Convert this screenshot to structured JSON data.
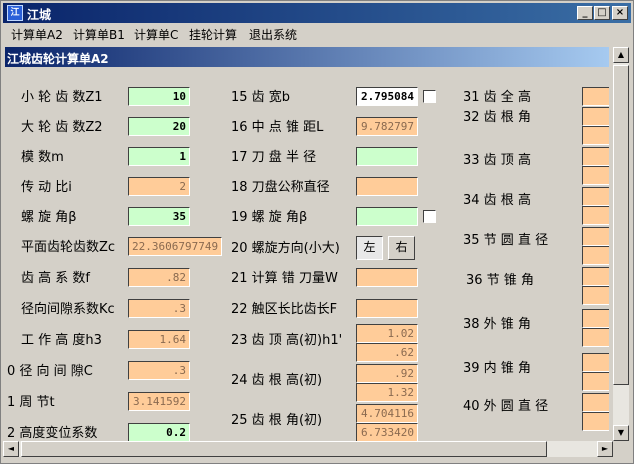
{
  "window": {
    "title": "江城",
    "icon": "app-icon"
  },
  "menu": [
    "计算单A2",
    "计算单B1",
    "计算单C",
    "挂轮计算",
    "退出系统"
  ],
  "child_title": "江城齿轮计算单A2",
  "col1": {
    "labels": [
      "小 轮 齿 数Z1",
      "大 轮 齿 数Z2",
      "模    数m",
      "传  动  比i",
      "螺  旋  角β",
      "平面齿轮齿数Zc",
      "齿 高 系 数f",
      "径向间隙系数Kc",
      "工 作  高 度h3",
      "0 径 向  间 隙C",
      "1 周         节t",
      "2 高度变位系数"
    ],
    "values": [
      "10",
      "20",
      "1",
      "2",
      "35",
      "22.3606797749",
      ".82",
      ".3",
      "1.64",
      ".3",
      "3.141592",
      "0.2"
    ]
  },
  "col2": {
    "labels": [
      "15 齿         宽b",
      "16 中 点  锥 距L",
      "17 刀 盘  半 径",
      "18 刀盘公称直径",
      "19 螺   旋   角β",
      "20 螺旋方向(小大)",
      "21 计算 错 刀量W",
      "22 触区长比齿长F",
      "23 齿 顶 高(初)h1'",
      "24 齿 根 高(初)",
      "25 齿 根 角(初)"
    ],
    "values": {
      "b": "2.795084",
      "L": "9.782797",
      "r": "",
      "D": "",
      "beta": "",
      "W": "",
      "F": "",
      "h1a": "1.02",
      "h1b": ".62",
      "hfa": ".92",
      "hfb": "1.32",
      "tha": "4.704116",
      "thb": "6.733420"
    },
    "dir_left": "左",
    "dir_right": "右"
  },
  "col3": {
    "labels": [
      "31 齿   全   高",
      "32 齿   根   角",
      "33 齿   顶   高",
      "34 齿   根   高",
      "35 节 圆  直 径",
      "36 节   锥   角",
      "38 外   锥   角",
      "39 内   锥   角",
      "40 外 圆  直 径"
    ]
  },
  "colors": {
    "green": "#ccffcc",
    "orange": "#ffcc99",
    "title_blue": "#0a246a"
  }
}
